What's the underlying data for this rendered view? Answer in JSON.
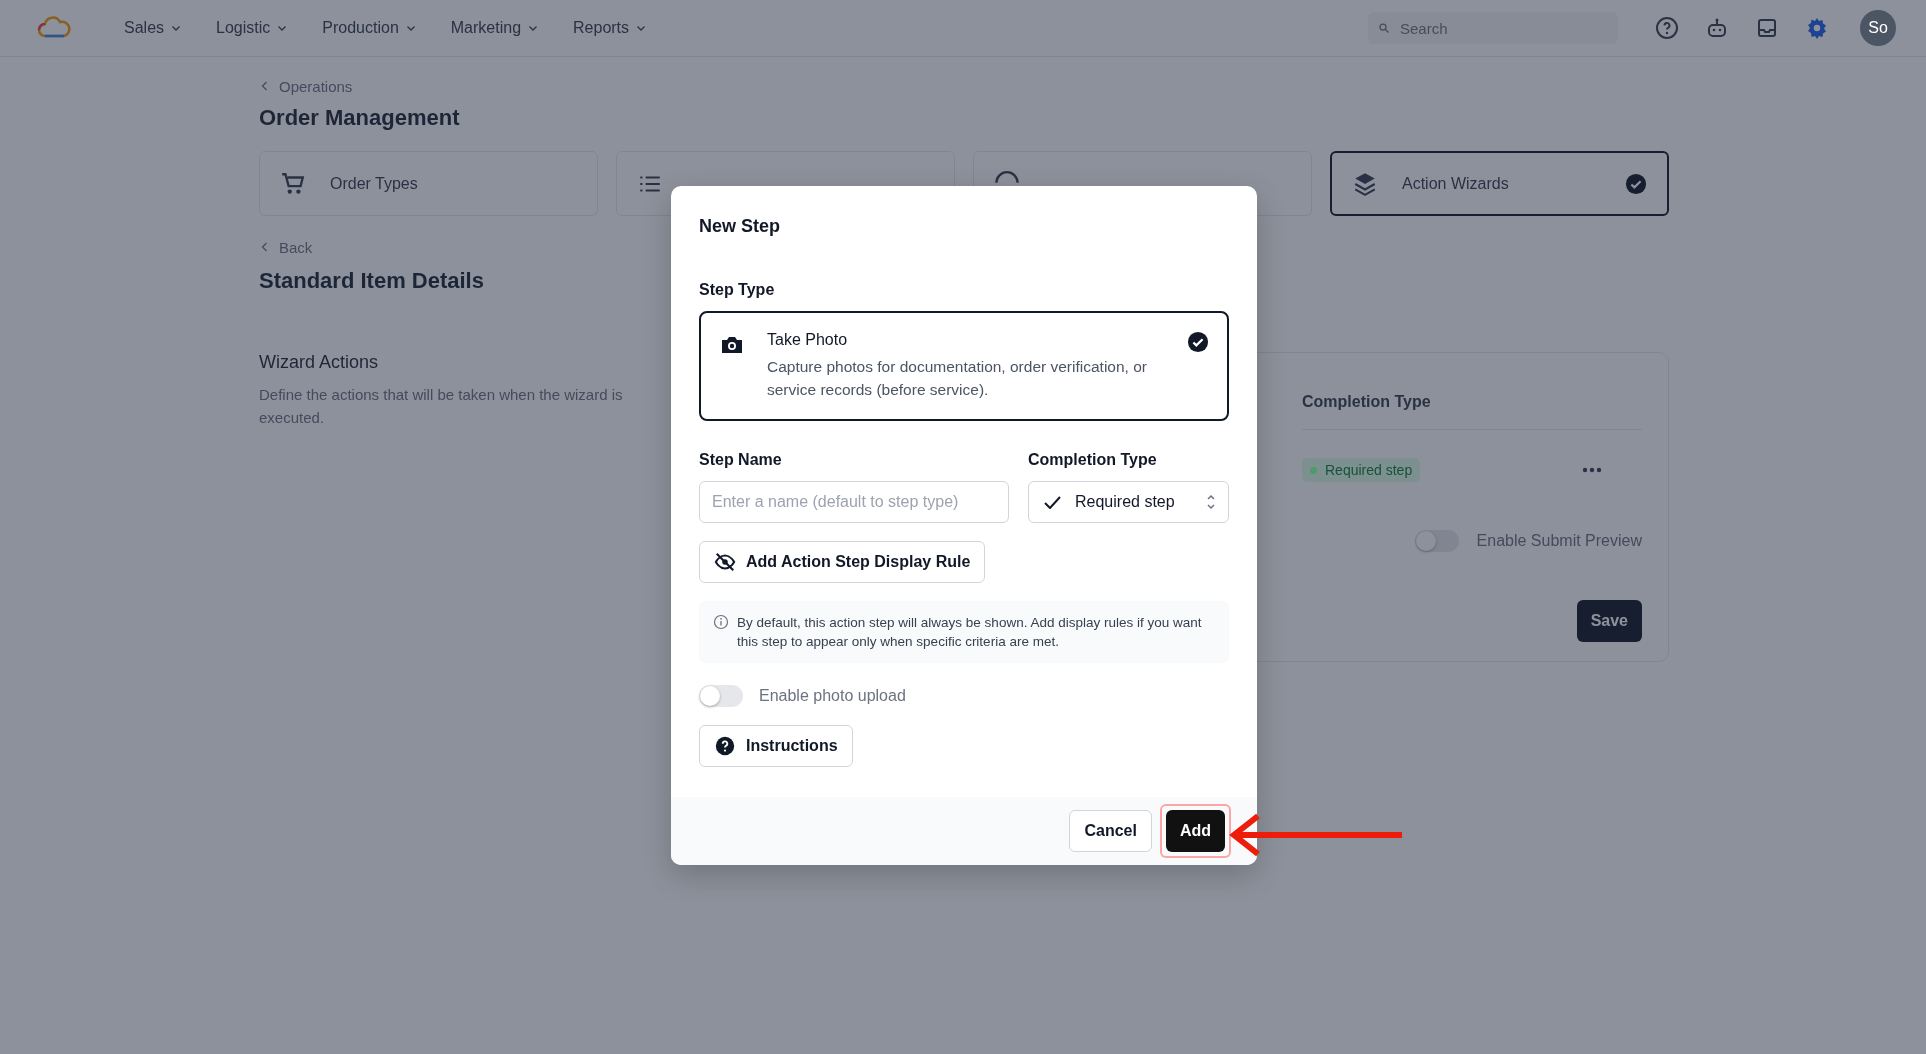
{
  "nav": {
    "menus": [
      {
        "label": "Sales"
      },
      {
        "label": "Logistic"
      },
      {
        "label": "Production"
      },
      {
        "label": "Marketing"
      },
      {
        "label": "Reports"
      }
    ],
    "search": {
      "placeholder": "Search"
    },
    "avatar": "So"
  },
  "page": {
    "breadcrumb": "Operations",
    "title": "Order Management",
    "cards": [
      {
        "kind": "cart",
        "label": "Order Types",
        "selected": false
      },
      {
        "kind": "list",
        "selected": false
      },
      {
        "kind": "circle",
        "selected": false
      },
      {
        "kind": "layers",
        "label": "Action Wizards",
        "selected": true
      }
    ],
    "back": "Back",
    "subtitle": "Standard Item Details",
    "section": {
      "title": "Wizard Actions",
      "description": "Define the actions that will be taken when the wizard is executed."
    },
    "table": {
      "columns": [
        "Completion Type"
      ],
      "rows": [
        {
          "completion": "Required step",
          "color": "#4f9a66"
        }
      ]
    },
    "preview_toggle": {
      "label": "Enable Submit Preview",
      "on": false
    },
    "save": "Save"
  },
  "modal": {
    "title": "New Step",
    "step_type_label": "Step Type",
    "step_option": {
      "title": "Take Photo",
      "description": "Capture photos for documentation, order verification, or service records (before service).",
      "selected": true
    },
    "step_name": {
      "label": "Step Name",
      "placeholder": "Enter a name (default to step type)"
    },
    "completion": {
      "label": "Completion Type",
      "value": "Required step"
    },
    "rule_button": "Add Action Step Display Rule",
    "info": "By default, this action step will always be shown. Add display rules if you want this step to appear only when specific criteria are met.",
    "photo_toggle": {
      "label": "Enable photo upload",
      "on": false
    },
    "instructions_button": "Instructions",
    "cancel": "Cancel",
    "add": "Add",
    "add_highlighted": true
  }
}
